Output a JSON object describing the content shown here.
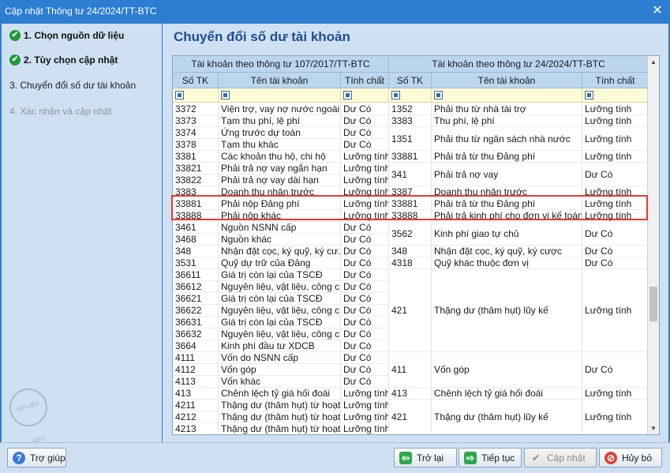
{
  "window": {
    "title": "Cập nhật Thông tư 24/2024/TT-BTC",
    "close_symbol": "✕"
  },
  "sidebar": {
    "steps": [
      {
        "label": "1. Chọn nguồn dữ liệu",
        "state": "done"
      },
      {
        "label": "2. Tùy chọn cập nhật",
        "state": "done"
      },
      {
        "label": "3. Chuyển đổi số dư tài khoản",
        "state": "current"
      },
      {
        "label": "4. Xác nhận và cập nhật",
        "state": "disabled"
      }
    ],
    "stamp_text": "DỮ LIỆU MẪU"
  },
  "main": {
    "heading": "Chuyển đổi số dư tài khoản"
  },
  "table": {
    "group_headers": [
      "Tài khoản theo thông tư 107/2017/TT-BTC",
      "Tài khoản theo thông tư 24/2024/TT-BTC"
    ],
    "columns": [
      "Số TK",
      "Tên tài khoản",
      "Tính chất",
      "Số TK",
      "Tên tài khoản",
      "Tính chất"
    ],
    "left_rows": [
      [
        "3372",
        "Viện trợ, vay nợ nước ngoài",
        "Dư Có"
      ],
      [
        "3373",
        "Tạm thu phí, lệ phí",
        "Dư Có"
      ],
      [
        "3374",
        "Ứng trước dự toán",
        "Dư Có"
      ],
      [
        "3378",
        "Tạm thu khác",
        "Dư Có"
      ],
      [
        "3381",
        "Các khoản thu hộ, chi hộ",
        "Lưỡng tính"
      ],
      [
        "33821",
        "Phải trả nợ vay ngắn hạn",
        "Lưỡng tính"
      ],
      [
        "33822",
        "Phải trả nợ vay dài hạn",
        "Lưỡng tính"
      ],
      [
        "3383",
        "Doanh thu nhận trước",
        "Lưỡng tính"
      ],
      [
        "33881",
        "Phải nộp Đảng phí",
        "Lưỡng tính"
      ],
      [
        "33888",
        "Phải nộp khác",
        "Lưỡng tính"
      ],
      [
        "3461",
        "Nguồn NSNN cấp",
        "Dư Có"
      ],
      [
        "3468",
        "Nguồn khác",
        "Dư Có"
      ],
      [
        "348",
        "Nhận đặt cọc, ký quỹ, ký cư...",
        "Dư Có"
      ],
      [
        "3531",
        "Quỹ dự trữ của Đảng",
        "Dư Có"
      ],
      [
        "36611",
        "Giá trị còn lại của TSCĐ",
        "Dư Có"
      ],
      [
        "36612",
        "Nguyên liệu, vật liệu, công c...",
        "Dư Có"
      ],
      [
        "36621",
        "Giá trị còn lại của TSCĐ",
        "Dư Có"
      ],
      [
        "36622",
        "Nguyên liệu, vật liệu, công c...",
        "Dư Có"
      ],
      [
        "36631",
        "Giá trị còn lại của TSCĐ",
        "Dư Có"
      ],
      [
        "36632",
        "Nguyên liệu, vật liệu, công c...",
        "Dư Có"
      ],
      [
        "3664",
        "Kinh phí đầu tư XDCB",
        "Dư Có"
      ],
      [
        "4111",
        "Vốn do NSNN cấp",
        "Dư Có"
      ],
      [
        "4112",
        "Vốn góp",
        "Dư Có"
      ],
      [
        "4113",
        "Vốn khác",
        "Dư Có"
      ],
      [
        "413",
        "Chênh lệch tỷ giá hối đoái",
        "Lưỡng tính"
      ],
      [
        "4211",
        "Thặng dư (thâm hụt) từ hoạt...",
        "Lưỡng tính"
      ],
      [
        "4212",
        "Thặng dư (thâm hụt) từ hoạt...",
        "Lưỡng tính"
      ],
      [
        "4213",
        "Thặng dư (thâm hụt) từ hoạt...",
        "Lưỡng tính"
      ]
    ],
    "right_rows": [
      {
        "cells": [
          "1352",
          "Phải thu từ nhà tài trợ",
          "Lưỡng tính"
        ],
        "span": 1
      },
      {
        "cells": [
          "3383",
          "Thu phí, lệ phí",
          "Lưỡng tính"
        ],
        "span": 1
      },
      {
        "cells": [
          "1351",
          "Phải thu từ ngân sách nhà nước",
          "Lưỡng tính"
        ],
        "span": 2
      },
      {
        "cells": [
          "33881",
          "Phải trả từ thu Đảng phí",
          "Lưỡng tính"
        ],
        "span": 1
      },
      {
        "cells": [
          "341",
          "Phải trả nợ vay",
          "Dư Có"
        ],
        "span": 2
      },
      {
        "cells": [
          "3387",
          "Doanh thu nhận trước",
          "Lưỡng tính"
        ],
        "span": 1
      },
      {
        "cells": [
          "33881",
          "Phải trả từ thu Đảng phí",
          "Lưỡng tính"
        ],
        "span": 1
      },
      {
        "cells": [
          "33888",
          "Phải trả kinh phí cho đơn vị kế toán...",
          "Lưỡng tính"
        ],
        "span": 1
      },
      {
        "cells": [
          "3562",
          "Kinh phí giao tự chủ",
          "Dư Có"
        ],
        "span": 2
      },
      {
        "cells": [
          "348",
          "Nhận đặt cọc, ký quỹ, ký cược",
          "Dư Có"
        ],
        "span": 1
      },
      {
        "cells": [
          "4318",
          "Quỹ khác thuộc đơn vị",
          "Dư Có"
        ],
        "span": 1
      },
      {
        "cells": [
          "421",
          "Thặng dư (thâm hụt) lũy kế",
          "Lưỡng tính"
        ],
        "span": 7
      },
      {
        "cells": [
          "411",
          "Vốn góp",
          "Dư Có"
        ],
        "span": 3
      },
      {
        "cells": [
          "413",
          "Chênh lệch tỷ giá hối đoái",
          "Lưỡng tính"
        ],
        "span": 1
      },
      {
        "cells": [
          "421",
          "Thặng dư (thâm hụt) lũy kế",
          "Lưỡng tính"
        ],
        "span": 3
      }
    ]
  },
  "scrollbar": {
    "up": "▲",
    "down": "▼"
  },
  "footer": {
    "help": "Trợ giúp",
    "back": "Trở lại",
    "next": "Tiếp tục",
    "update": "Cập nhật",
    "cancel": "Hủy bỏ"
  },
  "icons": {
    "help": "?",
    "back": "⇦",
    "next": "⇨",
    "update": "✔",
    "cancel": "⊘",
    "check": "✔"
  }
}
